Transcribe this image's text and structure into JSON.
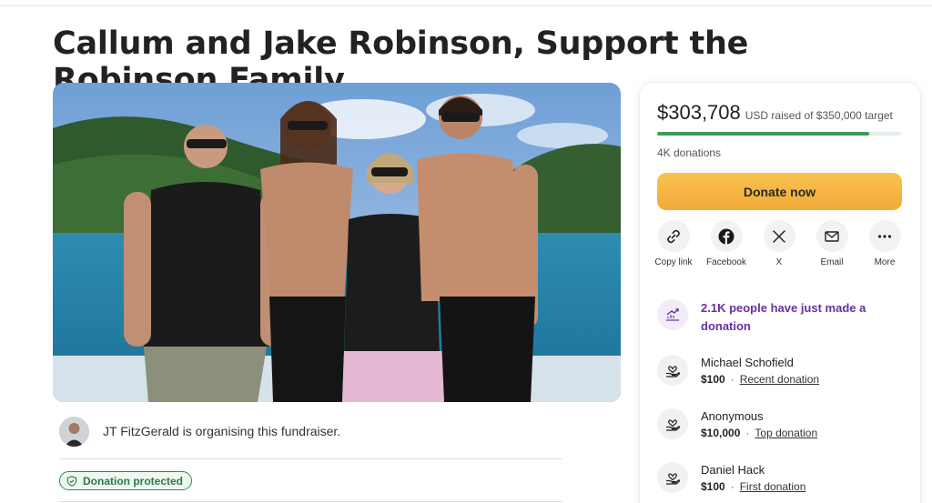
{
  "page": {
    "title": "Callum and Jake Robinson, Support the Robinson Family"
  },
  "organiser": {
    "text": "JT FitzGerald is organising this fundraiser."
  },
  "badge": {
    "label": "Donation protected"
  },
  "fundraiser": {
    "raised": "$303,708",
    "raised_suffix": "USD raised of $350,000 target",
    "progress_fraction": 0.868,
    "donations": "4K donations",
    "donate_label": "Donate now",
    "accent_color": "#f5b23f",
    "progress_color": "#3f9a5c"
  },
  "share": [
    {
      "label": "Copy link",
      "icon": "link-icon"
    },
    {
      "label": "Facebook",
      "icon": "facebook-icon"
    },
    {
      "label": "X",
      "icon": "x-icon"
    },
    {
      "label": "Email",
      "icon": "email-icon"
    },
    {
      "label": "More",
      "icon": "more-icon"
    }
  ],
  "feed": {
    "trend_text": "2.1K people have just made a donation",
    "trend_color": "#6a2fa0",
    "donors": [
      {
        "name": "Michael Schofield",
        "amount": "$100",
        "tag": "Recent donation"
      },
      {
        "name": "Anonymous",
        "amount": "$10,000",
        "tag": "Top donation"
      },
      {
        "name": "Daniel Hack",
        "amount": "$100",
        "tag": "First donation"
      }
    ]
  }
}
